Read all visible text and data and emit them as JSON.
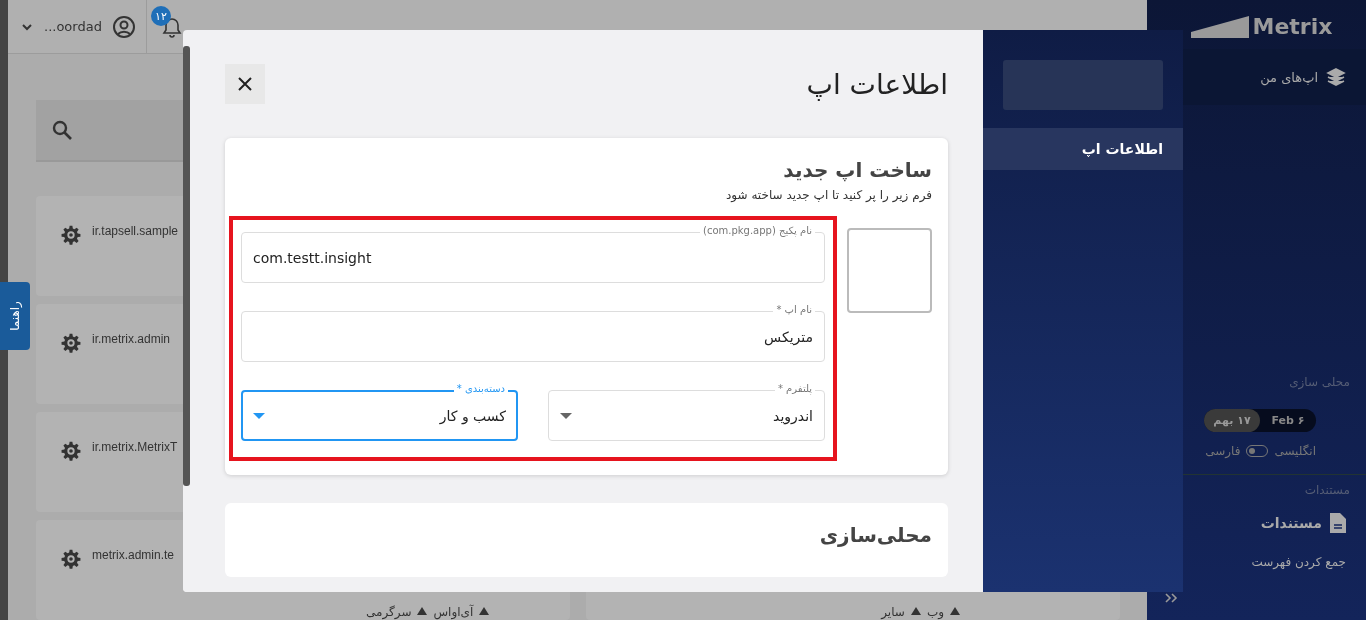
{
  "topbar": {
    "user": "...oordad",
    "badge": "۱۲"
  },
  "help_tab": "راهنما",
  "app_cards": [
    {
      "package": "ir.tapsell.sample"
    },
    {
      "package": "ir.metrix.admin"
    },
    {
      "package": "ir.metrix.MetrixT"
    },
    {
      "package": "metrix.admin.te"
    }
  ],
  "card_tags_left": [
    "آی‌اواس",
    "سرگرمی"
  ],
  "card_tags_right": [
    "وب",
    "سایر"
  ],
  "sidebar": {
    "logo": "Metrix",
    "nav": [
      {
        "label": "اپ‌های من"
      }
    ],
    "localization_heading": "محلی سازی",
    "calendar_toggle": [
      {
        "label": "Feb ۶",
        "selected": false
      },
      {
        "label": "۱۷ بهم",
        "selected": true
      }
    ],
    "language": {
      "left_label": "انگلیسی",
      "right_label": "فارسی",
      "on": false
    },
    "docs_heading": "مستندات",
    "docs_item": "مستندات",
    "collapse": "جمع کردن فهرست"
  },
  "modal": {
    "title": "اطلاعات اپ",
    "nav": [
      {
        "label": "اطلاعات اپ",
        "selected": true
      }
    ],
    "card": {
      "title": "ساخت اپ جدید",
      "subtitle": "فرم زیر را پر کنید تا اپ جدید ساخته شود",
      "fields": [
        {
          "kind": "text",
          "label": "نام پکیج (com.pkg.app)",
          "value": "com.testt.insight",
          "ltr": true,
          "focused": false
        },
        {
          "kind": "text",
          "label": "نام اپ *",
          "value": "متریکس",
          "ltr": false,
          "focused": false
        }
      ],
      "selects": [
        {
          "label": "پلتفرم *",
          "value": "اندروید",
          "focused": false
        },
        {
          "label": "دسته‌بندی *",
          "value": "کسب و کار",
          "focused": true
        }
      ]
    },
    "second_card": {
      "title": "محلی‌سازی"
    }
  }
}
